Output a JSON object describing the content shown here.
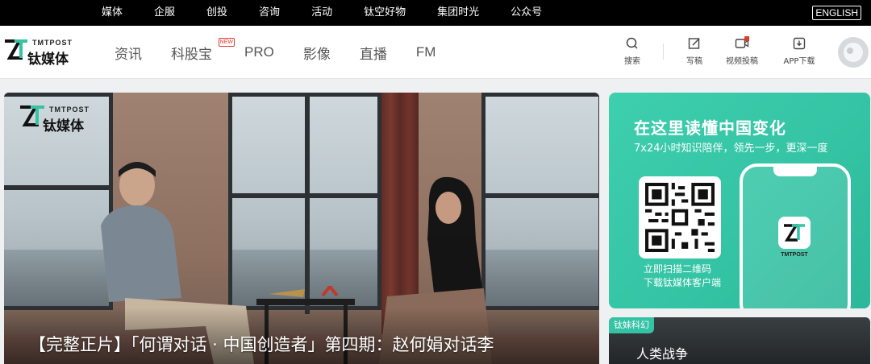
{
  "topbar": {
    "links": [
      "媒体",
      "企服",
      "创投",
      "咨询",
      "活动",
      "钛空好物",
      "集团时光",
      "公众号"
    ],
    "english_label": "ENGLISH"
  },
  "logo": {
    "brand_en": "TMTPOST",
    "brand_cn": "钛媒体"
  },
  "nav": {
    "items": [
      "资讯",
      "科股宝",
      "PRO",
      "影像",
      "直播",
      "FM"
    ],
    "new_badge": "NEW"
  },
  "tools": {
    "search": "搜索",
    "write": "写稿",
    "video": "视频投稿",
    "app": "APP下载"
  },
  "hero": {
    "caption": "【完整正片】「何谓对话 · 中国创造者」第四期：赵何娟对话李"
  },
  "promo": {
    "title": "在这里读懂中国变化",
    "subtitle": "7x24小时知识陪伴，领先一步，更深一度",
    "scan_line1": "立即扫描二维码",
    "scan_line2": "下载钛媒体客户端",
    "app_name": "TMTPOST"
  },
  "card2": {
    "tag": "钛妹科幻",
    "title": "人类战争"
  },
  "colors": {
    "accent": "#34c3a4",
    "topbar": "#000000",
    "new_badge": "#e03a2e"
  }
}
